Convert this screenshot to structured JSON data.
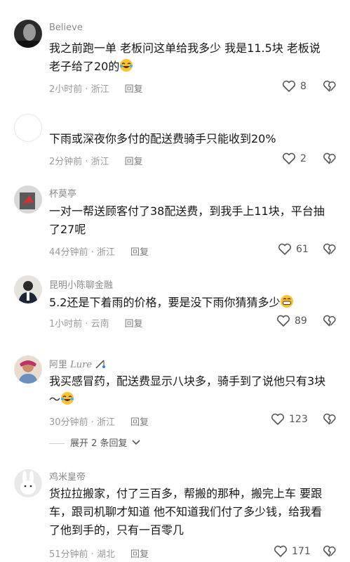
{
  "comments": [
    {
      "user": "Believe",
      "text": "我之前跑一单 老板问这单给我多少 我是11.5块 老板说老子给了20的",
      "time": "2小时前 · 浙江",
      "reply": "回复",
      "likes": "8",
      "emoji": "laugh-cry"
    },
    {
      "user": "",
      "text": "下雨或深夜你多付的配送费骑手只能收到20%",
      "time": "2分钟前 · 浙江",
      "reply": "回复",
      "likes": "2",
      "emoji": ""
    },
    {
      "user": "杯莫亭",
      "text": "一对一帮送顾客付了38配送费，到我手上11块，平台抽了27呢",
      "time": "44分钟前 · 浙江",
      "reply": "回复",
      "likes": "61",
      "emoji": ""
    },
    {
      "user": "昆明小陈聊金融",
      "text": "5.2还是下着雨的价格，要是没下雨你猜猜多少",
      "time": "1小时前 · 云南",
      "reply": "回复",
      "likes": "89",
      "emoji": "grin"
    },
    {
      "user": "阿里",
      "user_suffix": "Lure",
      "text": "我买感冒药，配送费显示八块多，骑手到了说他只有3块～",
      "time": "30分钟前 · 浙江",
      "reply": "回复",
      "likes": "123",
      "emoji": "laugh-cry"
    },
    {
      "user": "鸡米皇帝",
      "text": "货拉拉搬家，付了三百多，帮搬的那种，搬完上车 要跟车，跟司机聊才知道 他不知道我们付了多少钱，给我看了他到手的，只有一百零几",
      "time": "51分钟前 · 湖北",
      "reply": "回复",
      "likes": "171",
      "emoji": ""
    }
  ],
  "expand_replies": "展开 2 条回复",
  "icons": {
    "like": "heart-icon",
    "dislike": "broken-heart-icon",
    "expand": "chevron-down-icon",
    "fishing": "fishing-icon"
  }
}
